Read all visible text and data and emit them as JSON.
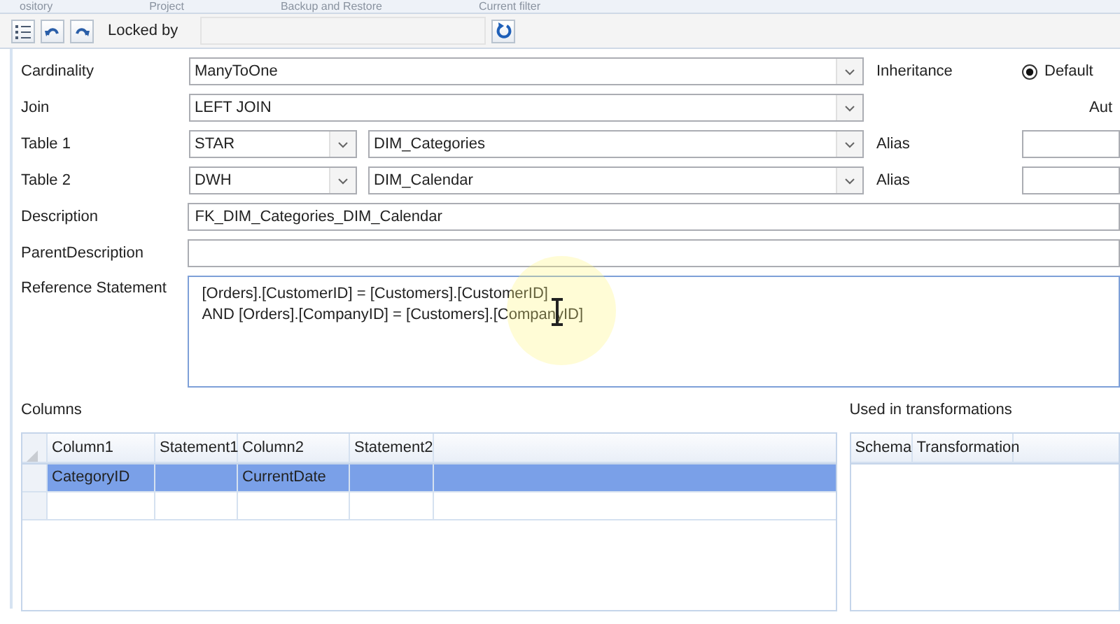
{
  "top_tabs": [
    "ository",
    "Project",
    "Backup and Restore",
    "Current filter"
  ],
  "toolbar": {
    "locked_by_label": "Locked by"
  },
  "form": {
    "cardinality": {
      "label": "Cardinality",
      "value": "ManyToOne"
    },
    "join": {
      "label": "Join",
      "value": "LEFT JOIN"
    },
    "table_1": {
      "label": "Table 1",
      "schema": "STAR",
      "table": "DIM_Categories",
      "alias_label": "Alias"
    },
    "table_2": {
      "label": "Table 2",
      "schema": "DWH",
      "table": "DIM_Calendar",
      "alias_label": "Alias"
    },
    "description": {
      "label": "Description",
      "value": "FK_DIM_Categories_DIM_Calendar"
    },
    "parent_description": {
      "label": "ParentDescription"
    },
    "reference_statement": {
      "label": "Reference Statement",
      "lines": [
        "[Orders].[CustomerID] = [Customers].[CustomerID]",
        "AND [Orders].[CompanyID] = [Customers].[CompanyID]"
      ]
    },
    "inheritance": {
      "label": "Inheritance",
      "options": [
        {
          "label": "Default",
          "selected": true
        }
      ],
      "option_2_partial": "Aut"
    }
  },
  "columns": {
    "label": "Columns",
    "headers": [
      "Column1",
      "Statement1",
      "Column2",
      "Statement2"
    ],
    "rows": [
      {
        "column1": "CategoryID",
        "column2": "CurrentDate",
        "selected": true
      }
    ]
  },
  "used_in_transformations": {
    "label": "Used in transformations",
    "headers": [
      "Schema",
      "Transformation"
    ]
  }
}
